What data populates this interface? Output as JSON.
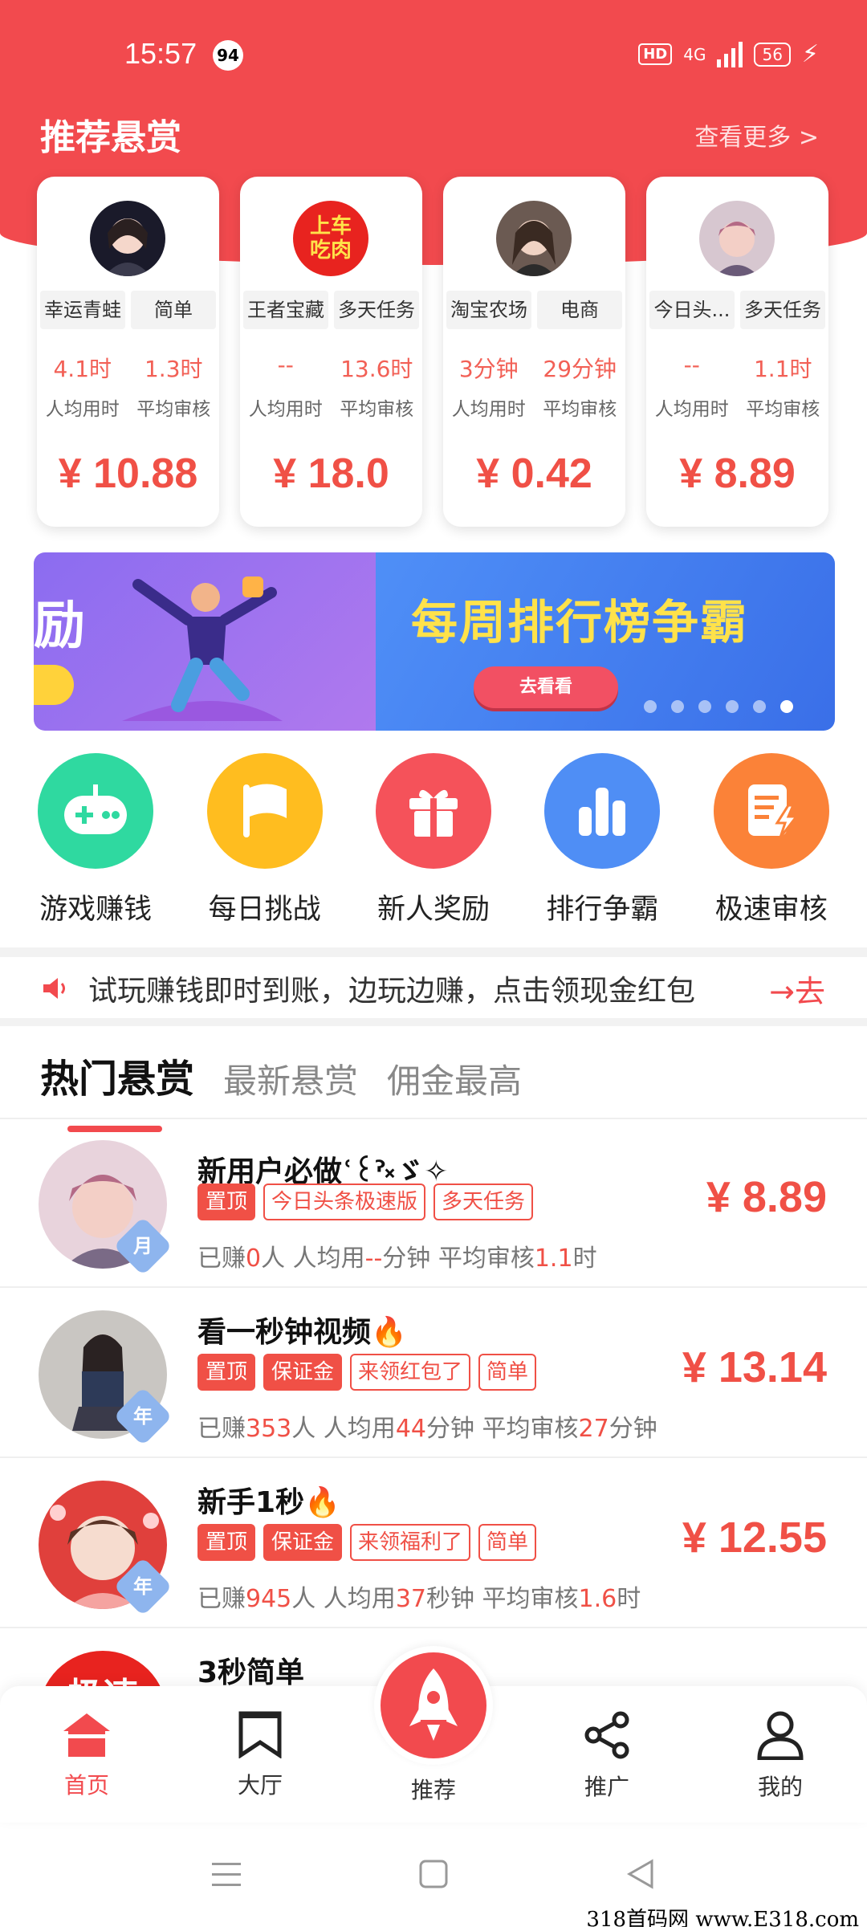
{
  "status_bar": {
    "time": "15:57",
    "notification_count": "94",
    "hd": "HD",
    "network": "4G",
    "battery": "56"
  },
  "recommended": {
    "title": "推荐悬赏",
    "view_more": "查看更多 >",
    "cards": [
      {
        "tag1": "幸运青蛙",
        "tag2": "简单",
        "time": "4.1时",
        "time_label": "人均用时",
        "review": "1.3时",
        "review_label": "平均审核",
        "price": "¥ 10.88"
      },
      {
        "tag1": "王者宝藏",
        "tag2": "多天任务",
        "time": "--",
        "time_label": "人均用时",
        "review": "13.6时",
        "review_label": "平均审核",
        "price": "¥ 18.0",
        "avatar_text": "上车吃肉"
      },
      {
        "tag1": "淘宝农场",
        "tag2": "电商",
        "time": "3分钟",
        "time_label": "人均用时",
        "review": "29分钟",
        "review_label": "平均审核",
        "price": "¥ 0.42"
      },
      {
        "tag1": "今日头...",
        "tag2": "多天任务",
        "time": "--",
        "time_label": "人均用时",
        "review": "1.1时",
        "review_label": "平均审核",
        "price": "¥ 8.89"
      }
    ]
  },
  "banner": {
    "left_text": "励",
    "title": "每周排行榜争霸",
    "button": "去看看"
  },
  "quick_actions": [
    {
      "label": "游戏赚钱",
      "color": "#2fd9a0",
      "icon": "gamepad-icon"
    },
    {
      "label": "每日挑战",
      "color": "#ffbd1f",
      "icon": "flag-icon"
    },
    {
      "label": "新人奖励",
      "color": "#f5525a",
      "icon": "gift-icon"
    },
    {
      "label": "排行争霸",
      "color": "#4f8ef5",
      "icon": "bar-chart-icon"
    },
    {
      "label": "极速审核",
      "color": "#fb8238",
      "icon": "fast-review-icon"
    }
  ],
  "notice": {
    "text": "试玩赚钱即时到账，边玩边赚，点击领现金红包",
    "action": "→去"
  },
  "tabs": [
    "热门悬赏",
    "最新悬赏",
    "佣金最高"
  ],
  "tasks": [
    {
      "title": "新用户必做ʿ꒰ˀ༝ゞ✧",
      "tier": "月",
      "tags": [
        "置顶",
        "今日头条极速版",
        "多天任务"
      ],
      "earned_pre": "已赚",
      "earned": "0",
      "earned_post": "人 人均用",
      "avg": "--",
      "avg_post": "分钟 平均审核",
      "review": "1.1",
      "review_post": "时",
      "price": "¥ 8.89"
    },
    {
      "title": "看一秒钟视频🔥",
      "tier": "年",
      "tags": [
        "置顶",
        "保证金",
        "来领红包了",
        "简单"
      ],
      "earned_pre": "已赚",
      "earned": "353",
      "earned_post": "人 人均用",
      "avg": "44",
      "avg_post": "分钟 平均审核",
      "review": "27",
      "review_post": "分钟",
      "price": "¥ 13.14"
    },
    {
      "title": "新手1秒🔥",
      "tier": "年",
      "tags": [
        "置顶",
        "保证金",
        "来领福利了",
        "简单"
      ],
      "earned_pre": "已赚",
      "earned": "945",
      "earned_post": "人 人均用",
      "avg": "37",
      "avg_post": "秒钟 平均审核",
      "review": "1.6",
      "review_post": "时",
      "price": "¥ 12.55"
    },
    {
      "title": "3秒简单",
      "avatar_text": "极速"
    }
  ],
  "bottom_nav": {
    "home": "首页",
    "hall": "大厅",
    "recommend": "推荐",
    "promote": "推广",
    "mine": "我的"
  },
  "watermark": "318首码网 www.E318.com"
}
